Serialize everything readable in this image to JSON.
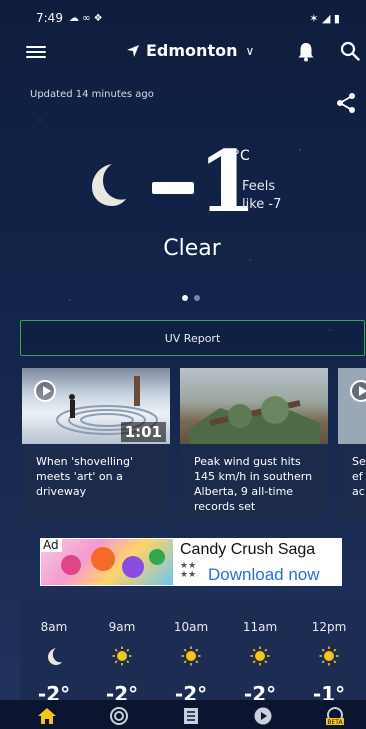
{
  "status_bar": {
    "time": "7:49",
    "left_icons": "☁ ∞ ❖",
    "right_icons": "✶ ◢ ▮"
  },
  "header": {
    "location": "Edmonton"
  },
  "updated": "Updated 14 minutes ago",
  "current": {
    "temp_sign": "–",
    "temp_value": "1",
    "unit": "°C",
    "feels_label": "Feels",
    "feels_value": "like -7",
    "condition": "Clear",
    "page_count": 2,
    "active_page": 1
  },
  "uv_report_label": "UV Report",
  "videos": [
    {
      "title": "When 'shovelling' meets 'art' on a driveway",
      "duration": "1:01"
    },
    {
      "title": "Peak wind gust hits 145 km/h in southern Alberta, 9 all-time records set",
      "duration": ""
    },
    {
      "title": "Se ef ac",
      "duration": ""
    }
  ],
  "ad": {
    "tag": "Ad",
    "title": "Candy Crush Saga",
    "cta": "Download now"
  },
  "hourly": [
    {
      "time": "8am",
      "icon": "moon-icon",
      "temp": "-2°"
    },
    {
      "time": "9am",
      "icon": "sun-icon",
      "temp": "-2°"
    },
    {
      "time": "10am",
      "icon": "sun-icon",
      "temp": "-2°"
    },
    {
      "time": "11am",
      "icon": "sun-icon",
      "temp": "-2°"
    },
    {
      "time": "12pm",
      "icon": "sun-icon",
      "temp": "-1°"
    }
  ],
  "bottom_nav": [
    {
      "icon": "home-icon",
      "active": true
    },
    {
      "icon": "radar-icon",
      "active": false
    },
    {
      "icon": "news-icon",
      "active": false
    },
    {
      "icon": "video-icon",
      "active": false
    },
    {
      "icon": "beta-icon",
      "active": false,
      "badge": "BETA"
    }
  ],
  "colors": {
    "background": "#13254b",
    "uv_border": "#3ba35a",
    "sun": "#f5c518",
    "active_nav": "#f5c518",
    "ad_link": "#2a6fd6"
  }
}
